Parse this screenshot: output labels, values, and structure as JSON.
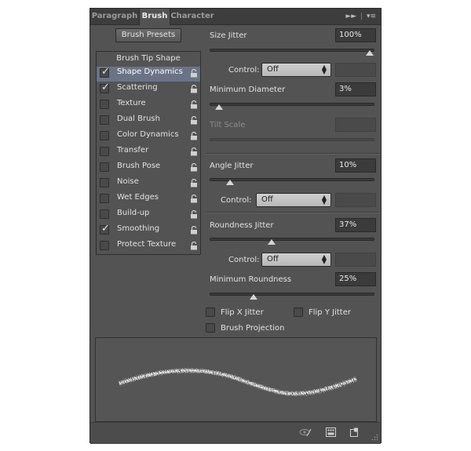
{
  "tabs": [
    {
      "label": "Paragraph"
    },
    {
      "label": "Brush"
    },
    {
      "label": "Character"
    }
  ],
  "presets_button": "Brush Presets",
  "list": {
    "header": "Brush Tip Shape",
    "items": [
      {
        "label": "Shape Dynamics",
        "checked": true,
        "selected": true
      },
      {
        "label": "Scattering",
        "checked": true
      },
      {
        "label": "Texture",
        "checked": false
      },
      {
        "label": "Dual Brush",
        "checked": false
      },
      {
        "label": "Color Dynamics",
        "checked": false
      },
      {
        "label": "Transfer",
        "checked": false
      },
      {
        "label": "Brush Pose",
        "checked": false
      },
      {
        "label": "Noise",
        "checked": false
      },
      {
        "label": "Wet Edges",
        "checked": false
      },
      {
        "label": "Build-up",
        "checked": false
      },
      {
        "label": "Smoothing",
        "checked": true
      },
      {
        "label": "Protect Texture",
        "checked": false
      }
    ]
  },
  "settings": {
    "size_jitter": {
      "label": "Size Jitter",
      "value": "100%",
      "level": 1.0
    },
    "size_control": {
      "label": "Control:",
      "value": "Off"
    },
    "min_diameter": {
      "label": "Minimum Diameter",
      "value": "3%",
      "level": 0.03
    },
    "tilt_scale": {
      "label": "Tilt Scale"
    },
    "angle_jitter": {
      "label": "Angle Jitter",
      "value": "10%",
      "level": 0.1
    },
    "angle_control": {
      "label": "Control:",
      "value": "Off"
    },
    "roundness_jitter": {
      "label": "Roundness Jitter",
      "value": "37%",
      "level": 0.37
    },
    "roundness_control": {
      "label": "Control:",
      "value": "Off"
    },
    "min_roundness": {
      "label": "Minimum Roundness",
      "value": "25%",
      "level": 0.25
    }
  },
  "checkboxes": {
    "flip_x": "Flip X Jitter",
    "flip_y": "Flip Y Jitter",
    "projection": "Brush Projection"
  },
  "icons": [
    "collapse-panel-icon",
    "panel-menu-icon",
    "lock-icon",
    "toggle-brush-preview-icon",
    "brush-panel-grid-icon",
    "new-brush-icon",
    "resize-grip-icon"
  ]
}
